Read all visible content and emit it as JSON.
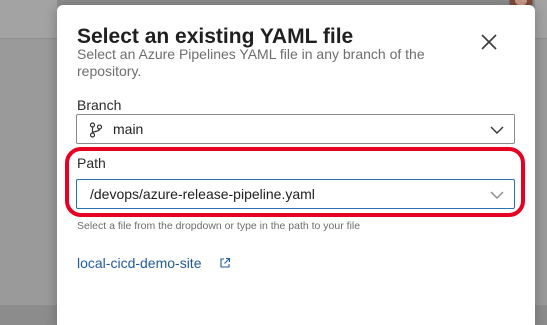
{
  "dialog": {
    "title": "Select an existing YAML file",
    "subtitle": "Select an Azure Pipelines YAML file in any branch of the repository.",
    "close_icon": "close-icon"
  },
  "branch": {
    "label": "Branch",
    "value": "main",
    "icon": "branch-icon"
  },
  "path": {
    "label": "Path",
    "value": "/devops/azure-release-pipeline.yaml",
    "hint": "Select a file from the dropdown or type in the path to your file"
  },
  "repo_link": {
    "text": "local-cicd-demo-site",
    "icon": "external-link-icon"
  },
  "colors": {
    "highlight": "#e60021",
    "link": "#1f5a9f",
    "focus_border": "#2a6fb0"
  }
}
